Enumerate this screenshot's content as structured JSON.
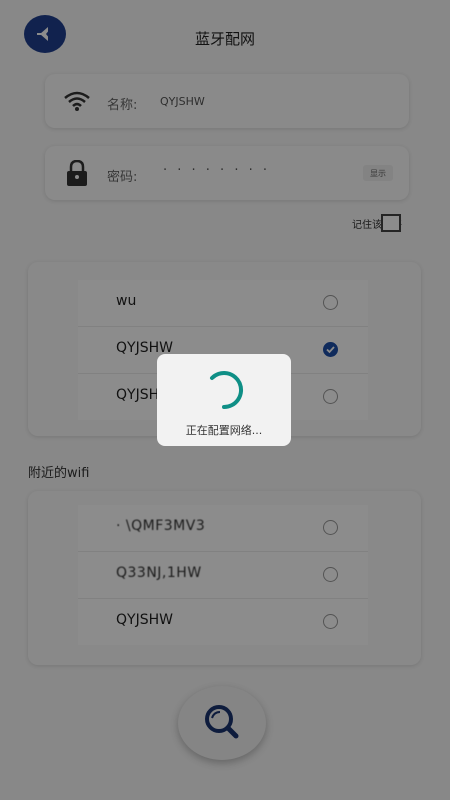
{
  "header": {
    "title": "蓝牙配网",
    "back_icon": "arrow-left-icon"
  },
  "name_field": {
    "icon": "wifi-icon",
    "label": "名称:",
    "value": "QYJSHW"
  },
  "password_field": {
    "icon": "lock-icon",
    "label": "密码:",
    "value": "· · · · · · · ·",
    "show_label": "显示"
  },
  "remember": {
    "label": "记住该网络",
    "checked": false
  },
  "saved_networks": [
    {
      "ssid": "wu",
      "selected": false
    },
    {
      "ssid": "QYJSHW",
      "selected": true
    },
    {
      "ssid": "QYJSHW",
      "selected": false
    }
  ],
  "nearby_title": "附近的wifi",
  "nearby_networks": [
    {
      "ssid": "·  \\QMF3MV3",
      "selected": false
    },
    {
      "ssid": "Q33NJ,1HW",
      "selected": false
    },
    {
      "ssid": "QYJSHW",
      "selected": false
    }
  ],
  "loading_dialog": {
    "text": "正在配置网络..."
  },
  "colors": {
    "accent": "#1e4fa8",
    "spinner": "#0f8f86",
    "background": "#f7f7f7"
  }
}
